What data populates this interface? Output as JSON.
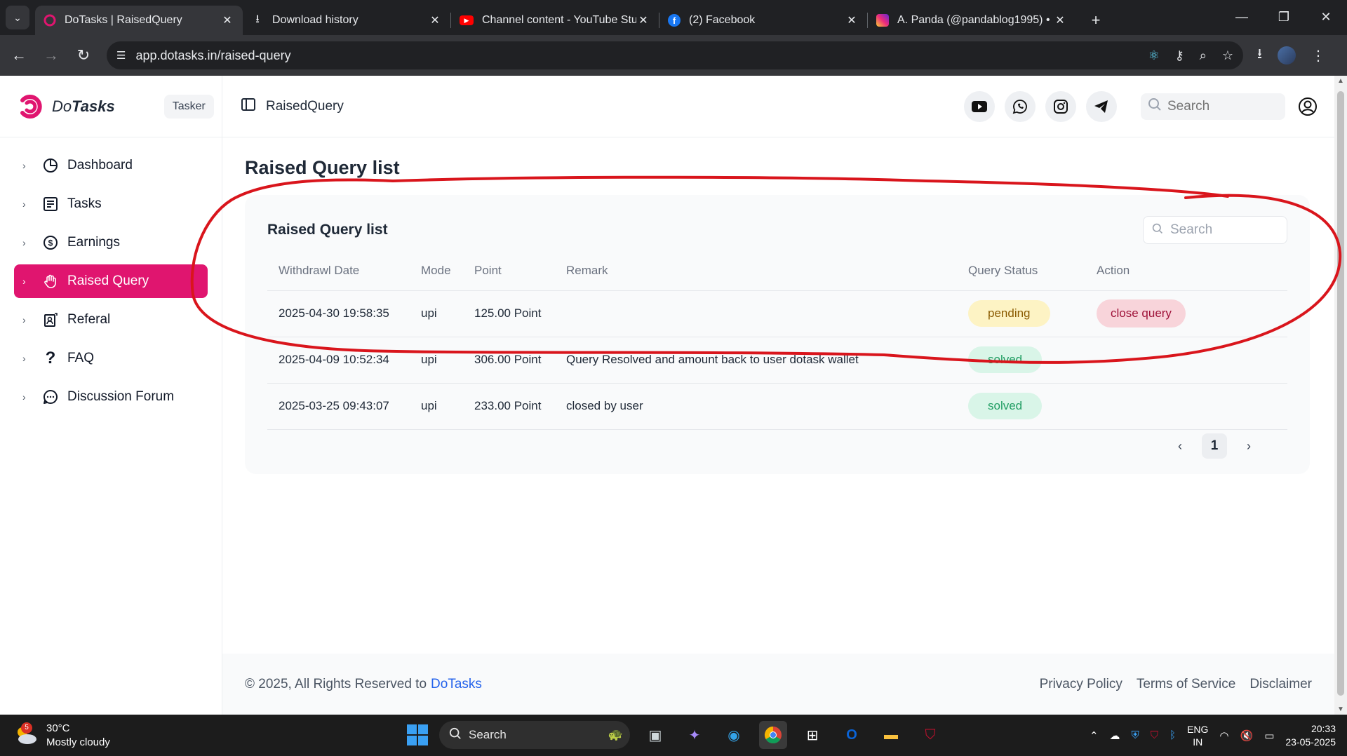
{
  "browser": {
    "tabs": [
      {
        "title": "DoTasks | RaisedQuery",
        "active": true
      },
      {
        "title": "Download history",
        "active": false
      },
      {
        "title": "Channel content - YouTube Studio",
        "active": false
      },
      {
        "title": "(2) Facebook",
        "active": false
      },
      {
        "title": "A. Panda (@pandablog1995) • Instagram",
        "active": false
      }
    ],
    "url": "app.dotasks.in/raised-query"
  },
  "brand": {
    "name_prefix": "Do",
    "name_suffix": "Tasks",
    "role": "Tasker",
    "color": "#e0156f"
  },
  "sidebar": {
    "items": [
      {
        "label": "Dashboard",
        "icon": "pie-chart-icon",
        "active": false
      },
      {
        "label": "Tasks",
        "icon": "list-icon",
        "active": false
      },
      {
        "label": "Earnings",
        "icon": "dollar-icon",
        "active": false
      },
      {
        "label": "Raised Query",
        "icon": "hand-icon",
        "active": true
      },
      {
        "label": "Referal",
        "icon": "referral-icon",
        "active": false
      },
      {
        "label": "FAQ",
        "icon": "question-icon",
        "active": false
      },
      {
        "label": "Discussion Forum",
        "icon": "chat-icon",
        "active": false
      }
    ]
  },
  "topbar": {
    "page_name": "RaisedQuery",
    "search_placeholder": "Search"
  },
  "content": {
    "page_title": "Raised Query list",
    "card_title": "Raised Query list",
    "search_placeholder": "Search",
    "columns": [
      "Withdrawl Date",
      "Mode",
      "Point",
      "Remark",
      "Query Status",
      "Action"
    ],
    "rows": [
      {
        "date": "2025-04-30 19:58:35",
        "mode": "upi",
        "point": "125.00 Point",
        "remark": "",
        "status": "pending",
        "action": "close query"
      },
      {
        "date": "2025-04-09 10:52:34",
        "mode": "upi",
        "point": "306.00 Point",
        "remark": "Query Resolved and amount back to user dotask wallet",
        "status": "solved",
        "action": ""
      },
      {
        "date": "2025-03-25 09:43:07",
        "mode": "upi",
        "point": "233.00 Point",
        "remark": "closed by user",
        "status": "solved",
        "action": ""
      }
    ],
    "current_page": "1"
  },
  "footer": {
    "copyright": "© 2025, All Rights Reserved to",
    "brand_link": "DoTasks",
    "links": [
      "Privacy Policy",
      "Terms of Service",
      "Disclaimer"
    ]
  },
  "taskbar": {
    "weather": {
      "badge": "5",
      "temp": "30°C",
      "desc": "Mostly cloudy"
    },
    "search_label": "Search",
    "lang_top": "ENG",
    "lang_bottom": "IN",
    "time": "20:33",
    "date": "23-05-2025"
  }
}
